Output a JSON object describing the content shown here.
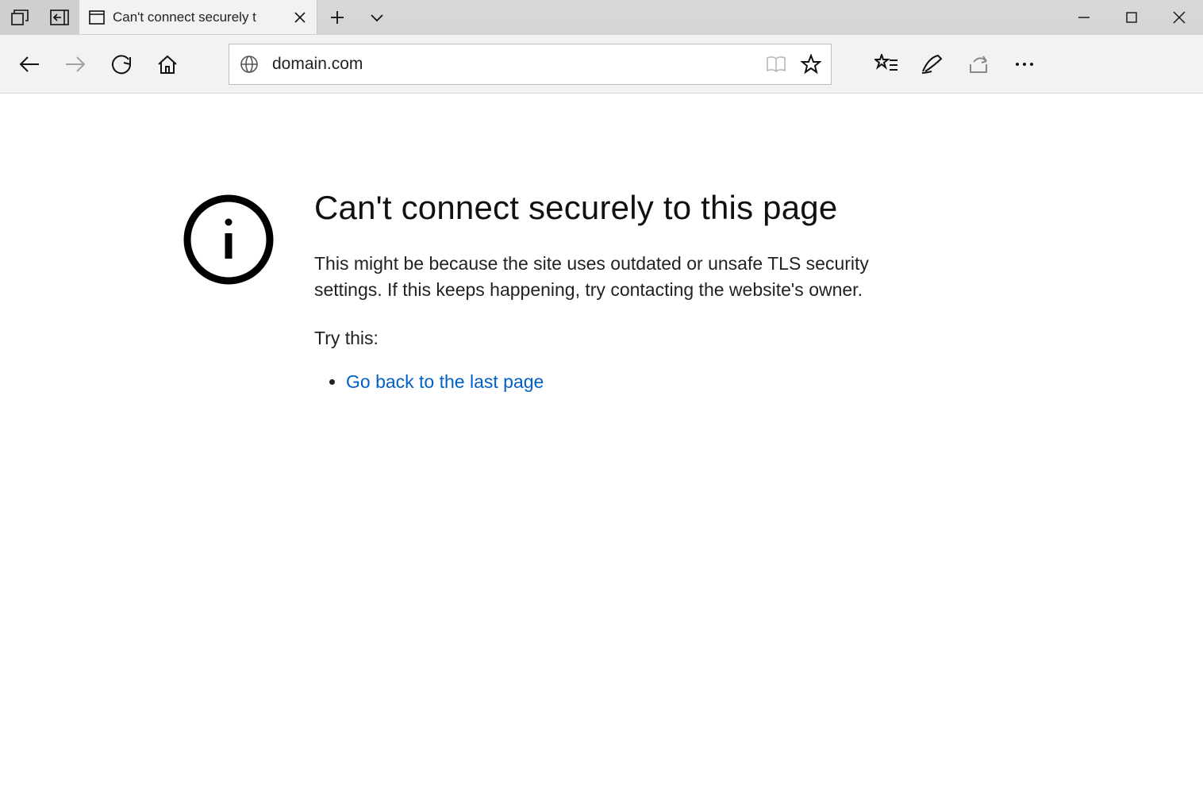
{
  "tab": {
    "title": "Can't connect securely t"
  },
  "address": {
    "url": "domain.com"
  },
  "error": {
    "title": "Can't connect securely to this page",
    "description": "This might be because the site uses outdated or unsafe TLS security settings. If this keeps happening, try contacting the website's owner.",
    "try_label": "Try this:",
    "suggestions": [
      {
        "text": "Go back to the last page"
      }
    ]
  }
}
